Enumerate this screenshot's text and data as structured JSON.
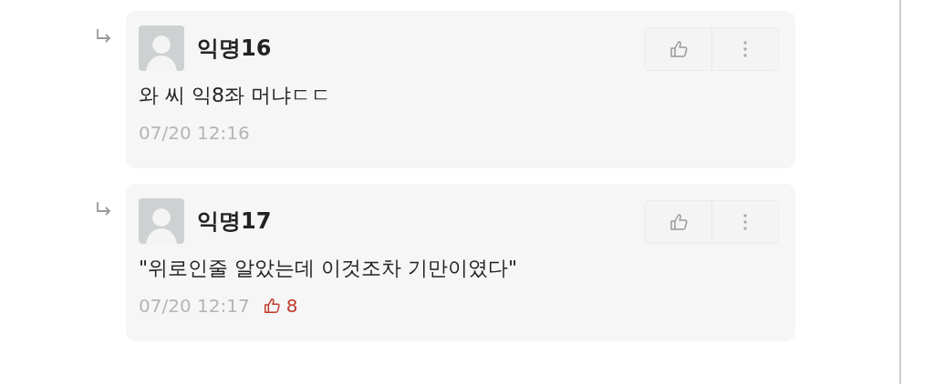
{
  "comments": [
    {
      "author": "익명16",
      "text": "와 씨 익8좌 머냐ㄷㄷ",
      "time": "07/20 12:16"
    },
    {
      "author": "익명17",
      "text": "\"위로인줄 알았는데 이것조차 기만이였다\"",
      "time": "07/20 12:17",
      "likes": "8"
    }
  ]
}
